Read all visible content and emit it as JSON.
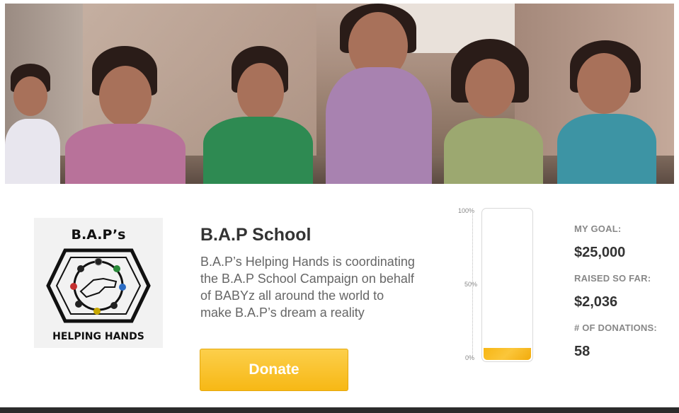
{
  "campaign": {
    "title": "B.A.P School",
    "description": "B.A.P’s Helping Hands is coordinating the B.A.P School Campaign on behalf of BABYz all around the world to make B.A.P’s dream a reality",
    "donate_label": "Donate"
  },
  "logo": {
    "top_text": "B.A.P’s",
    "bottom_text": "HELPING HANDS"
  },
  "gauge": {
    "label_100": "100%",
    "label_50": "50%",
    "label_0": "0%",
    "progress_fraction": 0.081,
    "fill_color": "#f7b614"
  },
  "stats": {
    "goal_label": "MY GOAL:",
    "goal_value": "$25,000",
    "raised_label": "RAISED SO FAR:",
    "raised_value": "$2,036",
    "donations_label": "# OF DONATIONS:",
    "donations_value": "58"
  },
  "colors": {
    "accent": "#f7b815",
    "footer": "#2b2b2b"
  }
}
